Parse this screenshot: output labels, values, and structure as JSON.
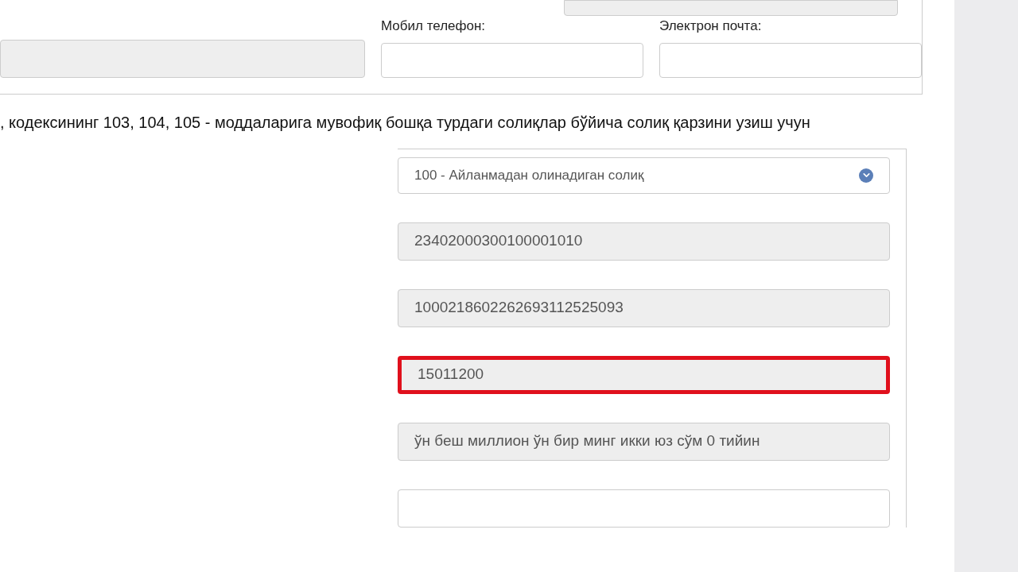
{
  "contact": {
    "fields": [
      {
        "label": "Мобил телефон:"
      },
      {
        "label": "Электрон почта:"
      }
    ]
  },
  "payment": {
    "legend": ", кодексининг 103, 104, 105 - моддаларига мувофиқ бошқа турдаги солиқлар бўйича солиқ қарзини узиш учун",
    "fields": [
      {
        "kind": "select",
        "value": "100 - Айланмадан олинадиган солиқ",
        "highlighted": false
      },
      {
        "kind": "readonly",
        "value": "23402000300100001010",
        "highlighted": false
      },
      {
        "kind": "readonly",
        "value": "1000218602262693112525093",
        "highlighted": false
      },
      {
        "kind": "readonly",
        "value": "15011200",
        "highlighted": true
      },
      {
        "kind": "readonly",
        "value": "ўн беш миллион ўн бир минг икки юз сўм 0 тийин",
        "highlighted": false
      },
      {
        "kind": "input",
        "highlighted": false
      }
    ]
  }
}
